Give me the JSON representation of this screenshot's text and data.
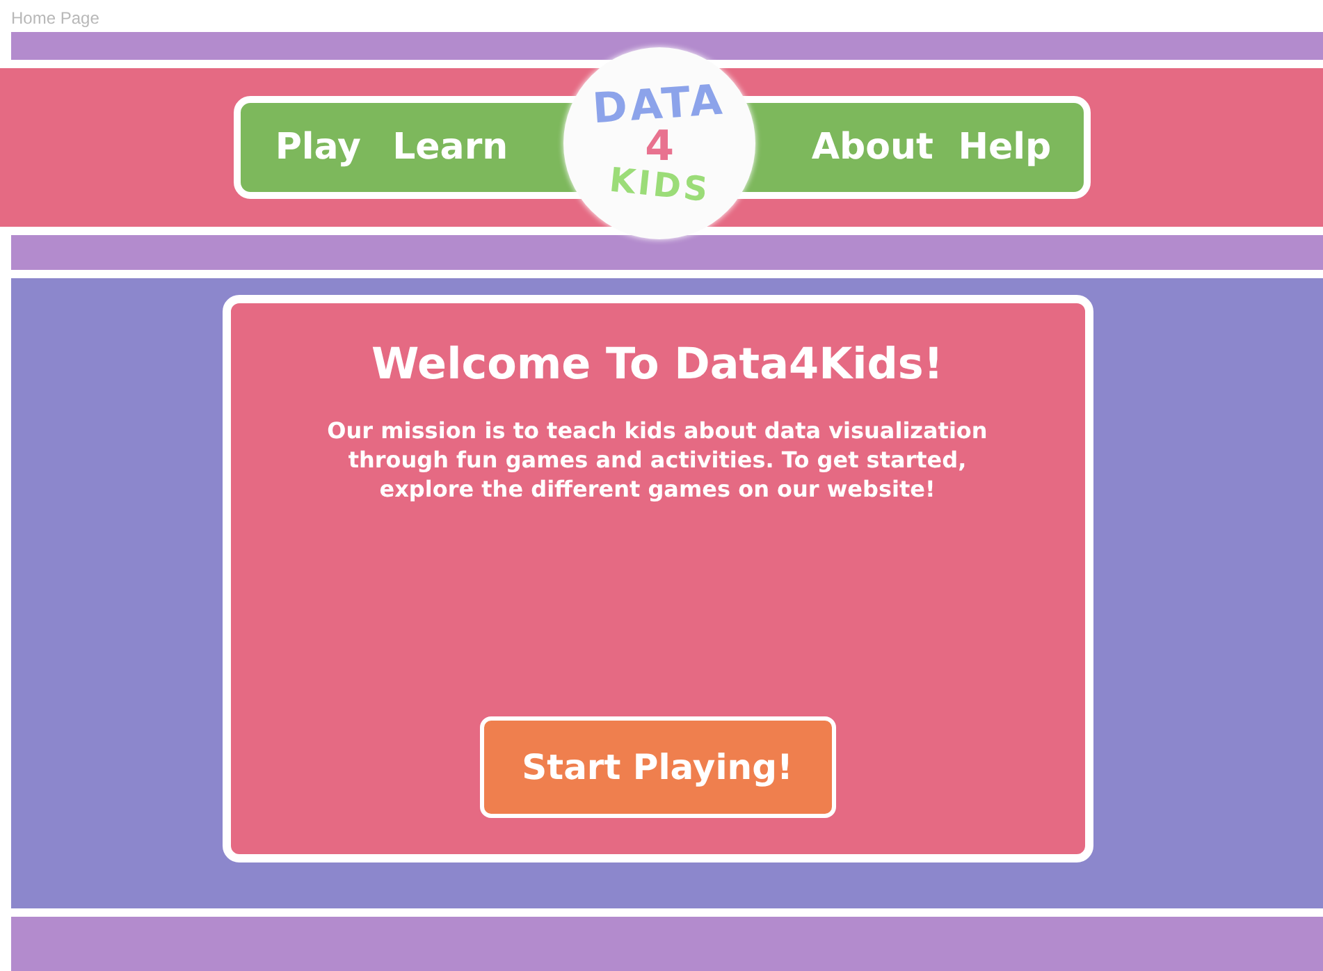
{
  "page_label": "Home Page",
  "nav": {
    "left": [
      {
        "label": "Play"
      },
      {
        "label": "Learn"
      }
    ],
    "right": [
      {
        "label": "About"
      },
      {
        "label": "Help"
      }
    ]
  },
  "logo": {
    "line_1": "DATA",
    "line_2": "4",
    "line_3": "KIDS"
  },
  "welcome": {
    "title": "Welcome To Data4Kids!",
    "text": "Our mission is to teach kids about data visualization through fun games and activities. To get started, explore the different games on our website!",
    "button": "Start Playing!"
  }
}
